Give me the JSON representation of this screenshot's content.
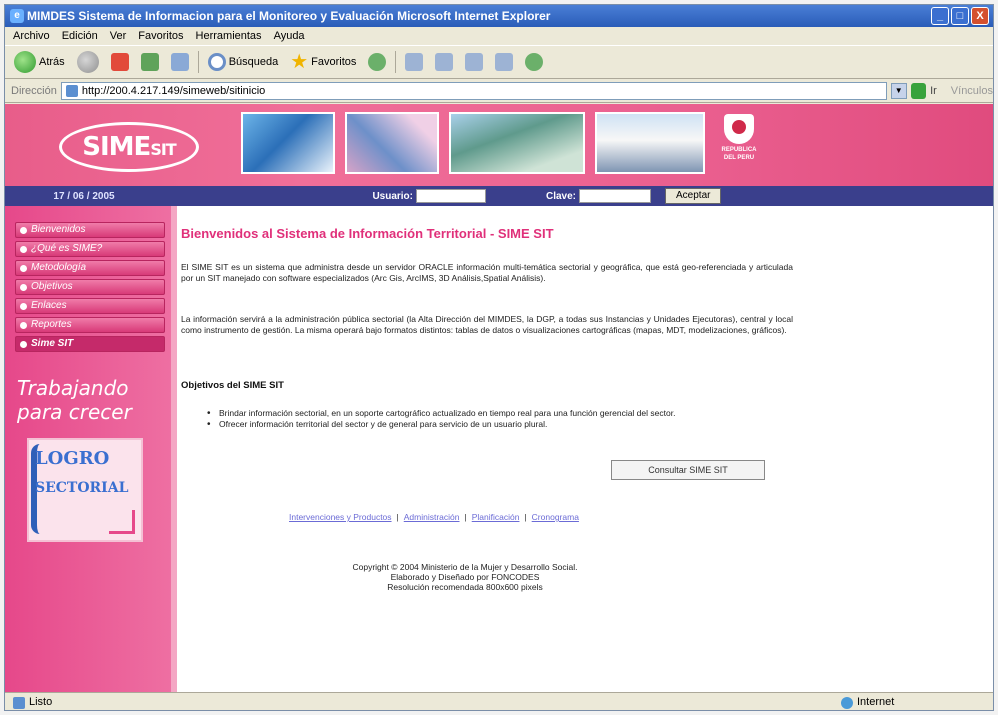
{
  "window": {
    "title": "MIMDES  Sistema de Informacion para el Monitoreo y Evaluación  Microsoft Internet Explorer",
    "controls": [
      "_",
      "□",
      "X"
    ]
  },
  "menu": [
    "Archivo",
    "Edición",
    "Ver",
    "Favoritos",
    "Herramientas",
    "Ayuda"
  ],
  "toolbar": {
    "back_label": "Atrás",
    "search_label": "Búsqueda",
    "favorites_label": "Favoritos"
  },
  "address": {
    "label": "Dirección",
    "url": "http://200.4.217.149/simeweb/sitinicio",
    "go_label": "Ir",
    "links_label": "Vínculos"
  },
  "page": {
    "logo_text": "SIME",
    "logo_sub": "SIT",
    "crest_text": "REPUBLICA DEL PERU",
    "date": "17 / 06 / 2005",
    "user_label": "Usuario:",
    "password_label": "Clave:",
    "accept_label": "Aceptar",
    "nav": [
      "Bienvenidos",
      "¿Qué es SIME?",
      "Metodología",
      "Objetivos",
      "Enlaces",
      "Reportes",
      "Sime SIT"
    ],
    "slogan_line1": "Trabajando",
    "slogan_line2": "para crecer",
    "logro_line1": "LOGRO",
    "logro_line2": "SECTORIAL",
    "welcome": "Bienvenidos al Sistema de Información Territorial - SIME SIT",
    "paragraph1": "El SIME SIT es un sistema que administra desde un servidor ORACLE información multi-temática sectorial y geográfica, que está geo-referenciada y articulada por un SIT manejado con software especializados (Arc Gis, ArcIMS, 3D Análisis,Spatial Análisis).",
    "paragraph2": "La información servirá a la administración pública sectorial (la Alta Dirección del MIMDES, la DGP, a todas sus Instancias y Unidades Ejecutoras), central y local como instrumento de gestión. La misma operará bajo formatos distintos: tablas de datos o visualizaciones cartográficas (mapas, MDT, modelizaciones, gráficos).",
    "objectives_title": "Objetivos del SIME SIT",
    "objectives": [
      "Brindar información sectorial, en un soporte cartográfico actualizado en tiempo real para una función gerencial del sector.",
      "Ofrecer información territorial del sector y de general para servicio de un usuario plural."
    ],
    "consult_button": "Consultar SIME SIT",
    "footer_links": [
      "Intervenciones y Productos",
      "Administración",
      "Planificación",
      "Cronograma"
    ],
    "copyright_line1": "Copyright © 2004 Ministerio de la Mujer y Desarrollo Social.",
    "copyright_line2": "Elaborado y Diseñado por FONCODES",
    "copyright_line3": "Resolución recomendada 800x600 pixels"
  },
  "status": {
    "left": "Listo",
    "right": "Internet"
  }
}
